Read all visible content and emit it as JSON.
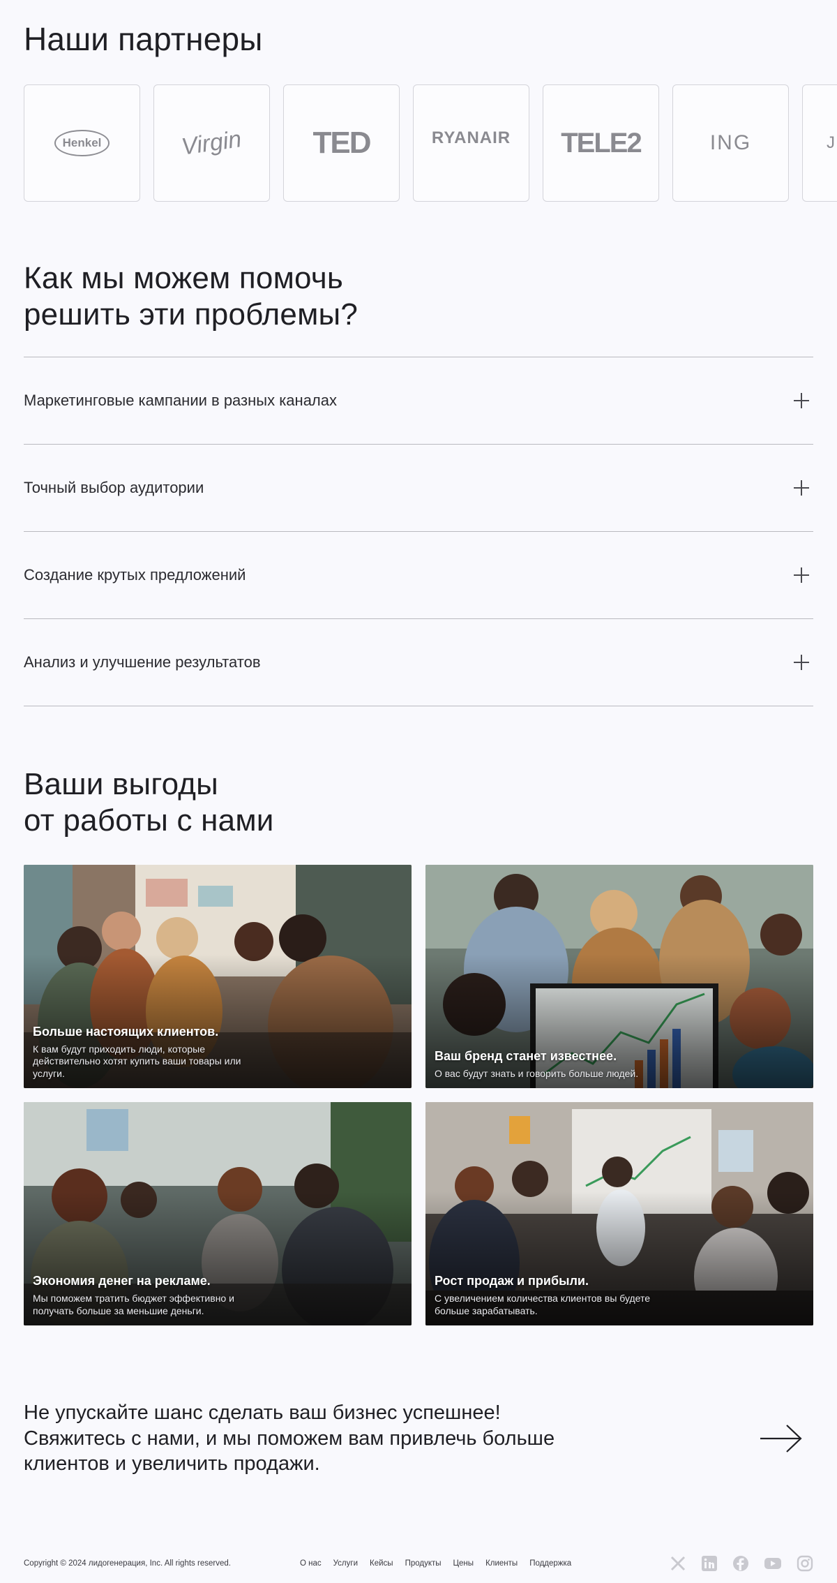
{
  "partners": {
    "title": "Наши партнеры",
    "logos": [
      "Henkel",
      "Virgin",
      "TED",
      "RYANAIR",
      "TELE2",
      "ING",
      "J"
    ]
  },
  "help": {
    "title_line1": "Как мы можем помочь",
    "title_line2": "решить эти проблемы?",
    "items": [
      "Маркетинговые кампании в разных каналах",
      "Точный выбор аудитории",
      "Создание крутых предложений",
      "Анализ и улучшение результатов"
    ]
  },
  "benefits": {
    "title_line1": "Ваши выгоды",
    "title_line2": "от работы с нами",
    "cards": [
      {
        "title": "Больше настоящих клиентов.",
        "desc": "К вам будут приходить люди, которые действительно хотят купить ваши товары или услуги."
      },
      {
        "title": "Ваш бренд станет известнее.",
        "desc": "О вас будут знать и говорить больше людей."
      },
      {
        "title": "Экономия денег на рекламе.",
        "desc": "Мы поможем тратить бюджет эффективно и получать больше за меньшие деньги."
      },
      {
        "title": "Рост продаж и прибыли.",
        "desc": "С увеличением количества клиентов вы будете больше зарабатывать."
      }
    ]
  },
  "cta": {
    "text": "Не упускайте шанс сделать ваш бизнес успешнее! Свяжитесь с нами, и мы поможем вам привлечь больше клиентов и увеличить продажи."
  },
  "footer": {
    "copyright": "Copyright © 2024 лидогенерация, Inc. All rights reserved.",
    "nav": [
      "О нас",
      "Услуги",
      "Кейсы",
      "Продукты",
      "Цены",
      "Клиенты",
      "Поддержка"
    ],
    "socials": [
      "x-icon",
      "linkedin-icon",
      "facebook-icon",
      "youtube-icon",
      "instagram-icon"
    ]
  }
}
